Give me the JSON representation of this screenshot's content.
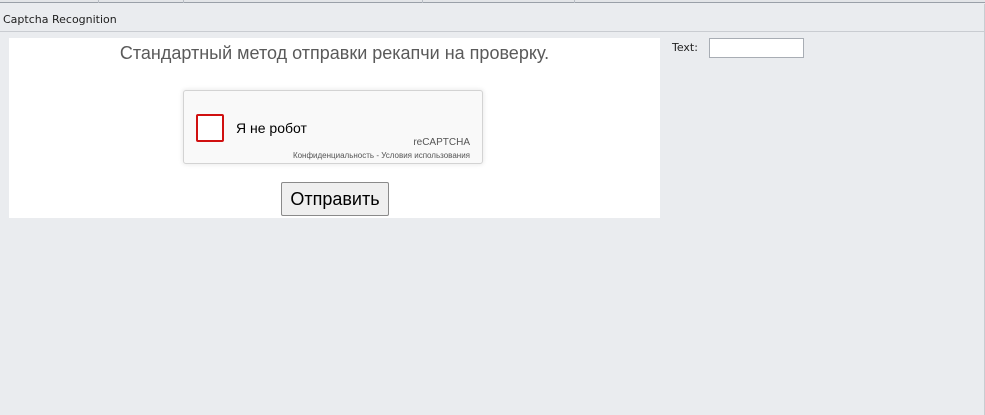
{
  "window": {
    "title": "Captcha Recognition"
  },
  "page": {
    "heading": "Стандартный метод отправки рекапчи на проверку.",
    "recaptcha": {
      "label": "Я не робот",
      "brand": "reCAPTCHA",
      "privacy_link": "Конфиденциальность",
      "separator": " - ",
      "terms_link": "Условия использования"
    },
    "submit_label": "Отправить"
  },
  "text_field": {
    "label": "Text:",
    "value": ""
  },
  "colors": {
    "checkbox_border": "#d01010",
    "background": "#eaecef",
    "panel": "#ffffff"
  }
}
